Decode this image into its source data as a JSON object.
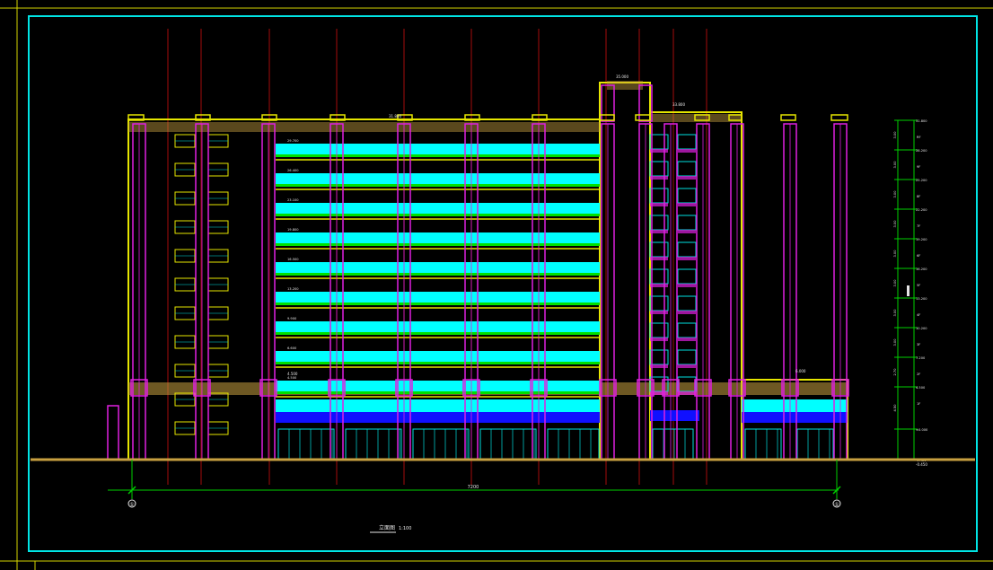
{
  "drawing": {
    "title": "立面图",
    "scale": "1:100",
    "overall_dimension": "7200",
    "axis_left": "①",
    "axis_right": "①",
    "ground_elevation": "-0.450",
    "roof_elevation_main": "31.800",
    "roof_elevation_tower": "35.000",
    "tower_elevation_right": "33.800",
    "annex_roof_elevation": "6.000",
    "podium_elevation": "4.500"
  },
  "floor_levels": [
    "29.700",
    "26.400",
    "23.100",
    "19.800",
    "16.500",
    "13.200",
    "9.900",
    "6.600",
    "4.500",
    "0.000"
  ],
  "level_scale": {
    "labels": [
      {
        "floor": "RF",
        "value": "31.800"
      },
      {
        "floor": "9F",
        "value": "28.200"
      },
      {
        "floor": "8F",
        "value": "25.200"
      },
      {
        "floor": "7F",
        "value": "22.200"
      },
      {
        "floor": "6F",
        "value": "19.200"
      },
      {
        "floor": "5F",
        "value": "16.200"
      },
      {
        "floor": "4F",
        "value": "13.200"
      },
      {
        "floor": "3F",
        "value": "10.200"
      },
      {
        "floor": "2F",
        "value": "7.200"
      },
      {
        "floor": "1F",
        "value": "4.500"
      },
      {
        "floor": "",
        "value": "±0.000"
      },
      {
        "floor": "",
        "value": "-0.450"
      }
    ],
    "segments": [
      "3.00",
      "3.00",
      "3.00",
      "3.00",
      "3.00",
      "3.00",
      "3.00",
      "3.00",
      "2.70",
      "4.50"
    ]
  },
  "colors": {
    "frame": "#00e5e5",
    "column": "#e020e0",
    "slab": "#e6e600",
    "band": "#00ffff",
    "rail": "#00e000",
    "grid": "#d01010",
    "parapet": "#c8a040",
    "glass_blue": "#1010ff",
    "window": "#b0b0b0"
  }
}
